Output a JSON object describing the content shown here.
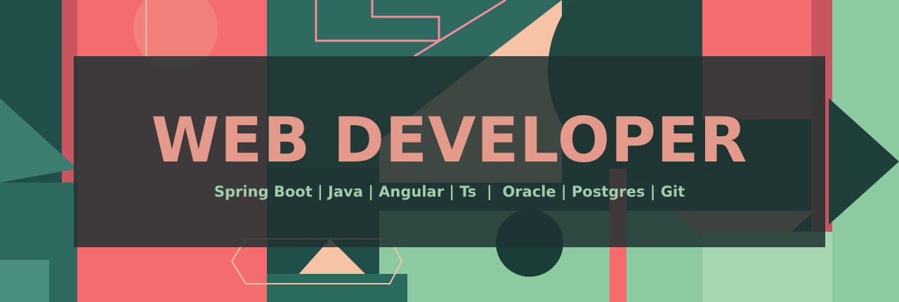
{
  "banner": {
    "title": "WEB DEVELOPER",
    "subtitle": "Spring Boot | Java | Angular | Ts  |  Oracle | Postgres | Git"
  },
  "colors": {
    "title": "#e39a8a",
    "subtitle": "#9fcea8",
    "overlay": "#1f3232",
    "pink": "#f56c6f",
    "mint": "#8ecaa1",
    "peach": "#f6c3a6",
    "dark_teal": "#1f4f48"
  }
}
